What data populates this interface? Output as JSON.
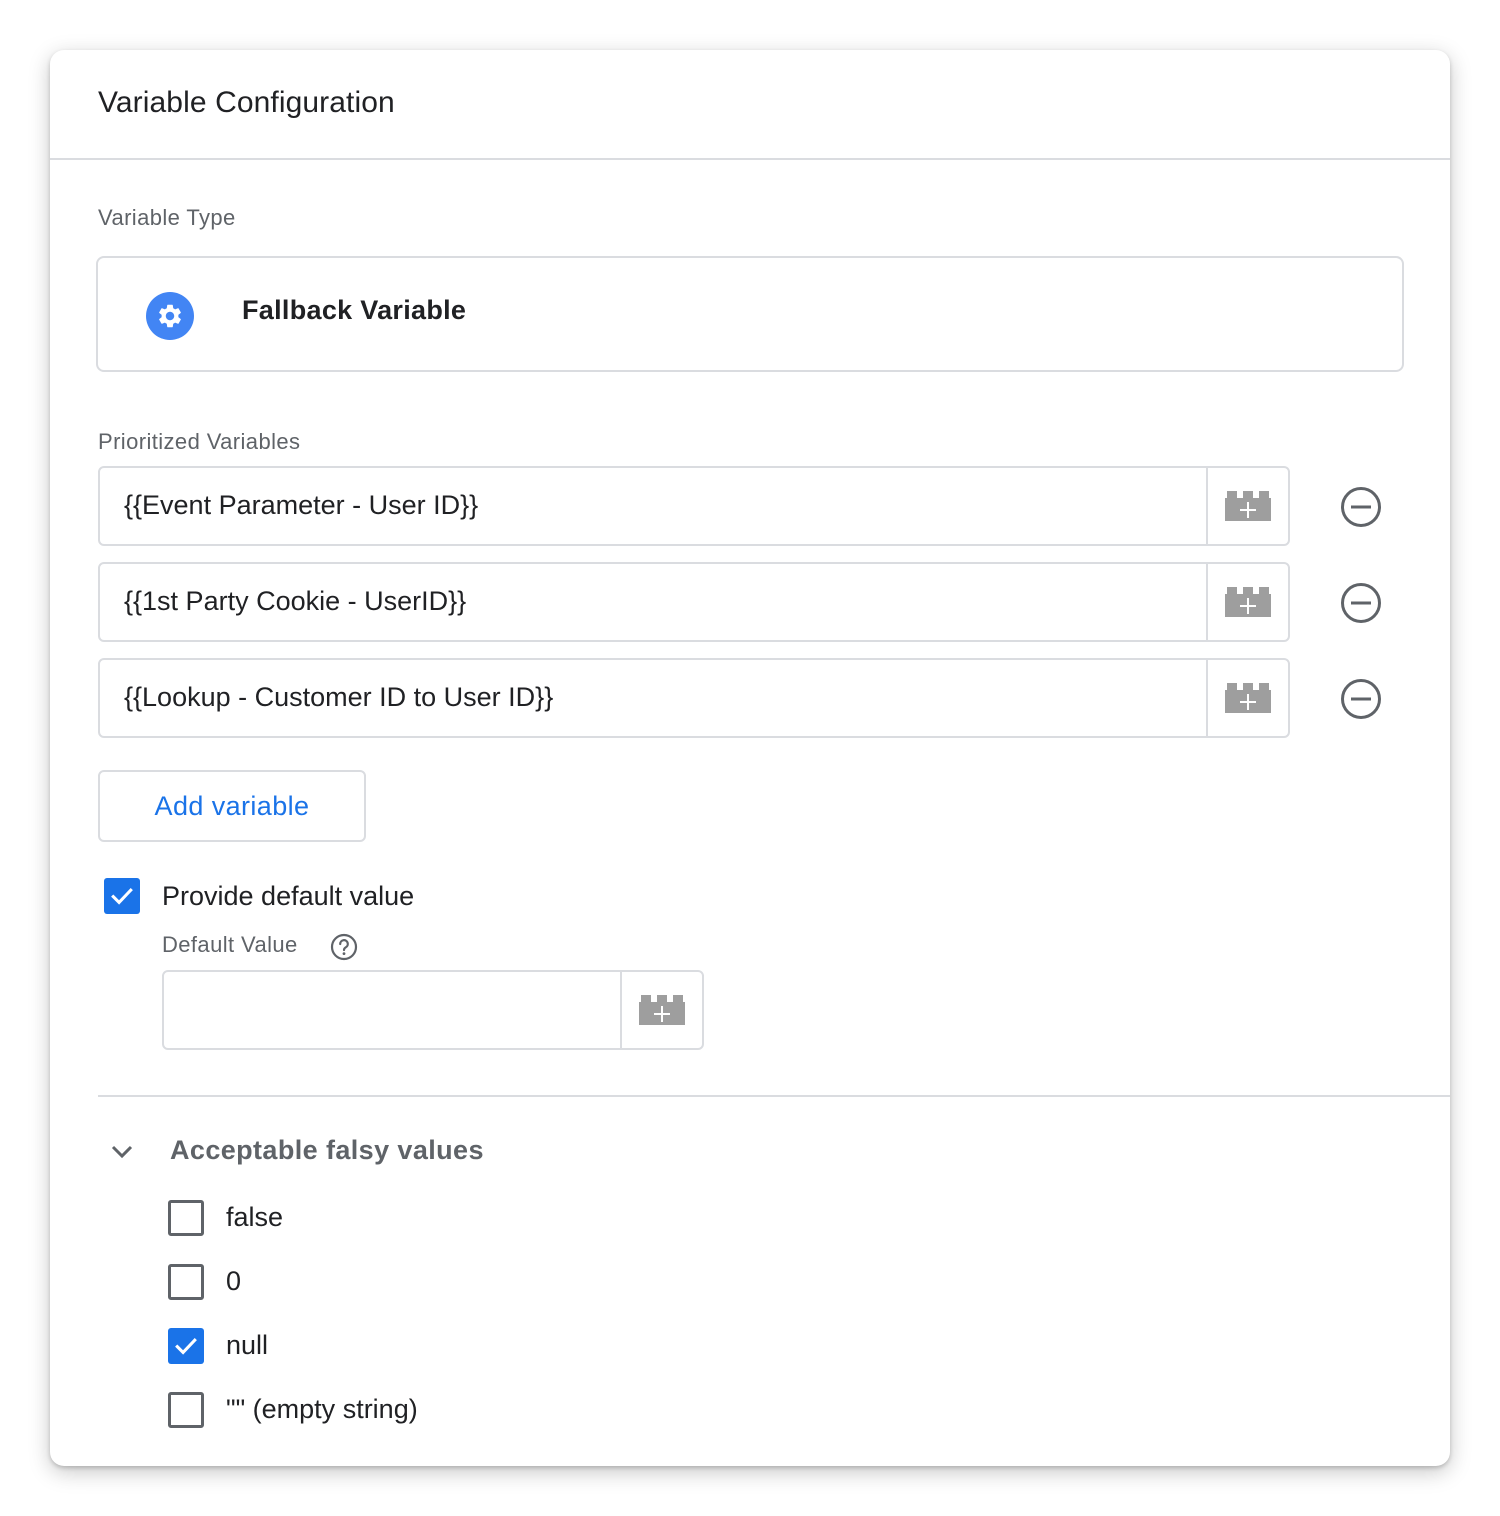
{
  "header": {
    "title": "Variable Configuration"
  },
  "variable_type": {
    "label": "Variable Type",
    "name": "Fallback Variable",
    "icon": "gear-icon",
    "icon_color": "#4285f4"
  },
  "prioritized": {
    "label": "Prioritized Variables",
    "items": [
      {
        "value": "{{Event Parameter - User ID}}"
      },
      {
        "value": "{{1st Party Cookie - UserID}}"
      },
      {
        "value": "{{Lookup - Customer ID to User ID}}"
      }
    ],
    "add_label": "Add variable"
  },
  "default_value": {
    "checkbox_label": "Provide default value",
    "checked": true,
    "field_label": "Default Value",
    "value": ""
  },
  "falsy": {
    "title": "Acceptable falsy values",
    "expanded": true,
    "options": [
      {
        "label": "false",
        "checked": false
      },
      {
        "label": "0",
        "checked": false
      },
      {
        "label": "null",
        "checked": true
      },
      {
        "label": "\"\" (empty string)",
        "checked": false
      }
    ]
  },
  "colors": {
    "accent": "#1a73e8",
    "border": "#dadce0",
    "muted_text": "#5f6368"
  }
}
